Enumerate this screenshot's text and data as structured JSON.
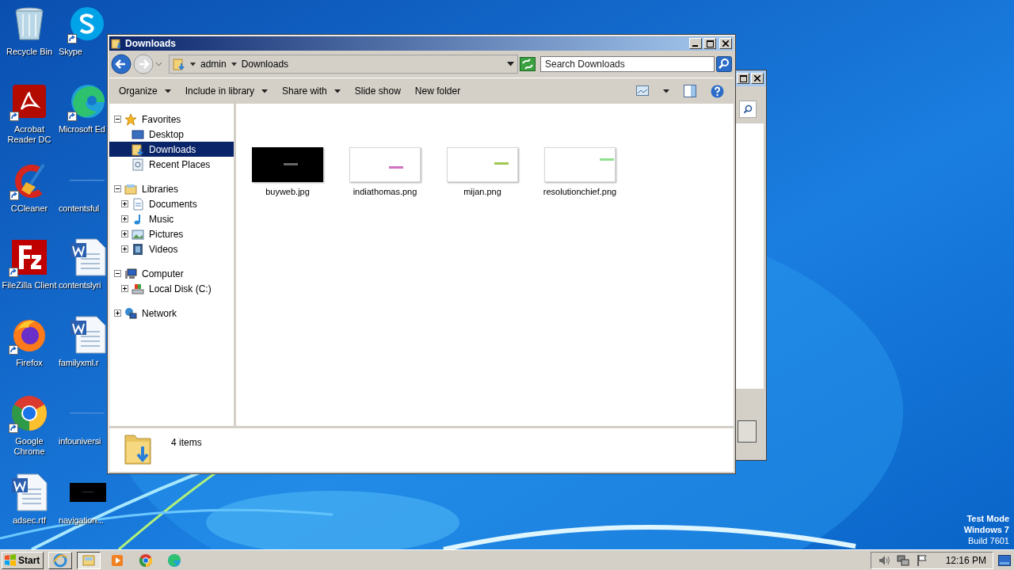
{
  "desktop_icons": [
    {
      "label": "Recycle Bin",
      "kind": "recycle",
      "shortcut": false
    },
    {
      "label": "Acrobat Reader DC",
      "kind": "acrobat",
      "shortcut": true
    },
    {
      "label": "CCleaner",
      "kind": "ccleaner",
      "shortcut": true
    },
    {
      "label": "FileZilla Client",
      "kind": "filezilla",
      "shortcut": true
    },
    {
      "label": "Firefox",
      "kind": "firefox",
      "shortcut": true
    },
    {
      "label": "Google Chrome",
      "kind": "chrome",
      "shortcut": true
    },
    {
      "label": "adsec.rtf",
      "kind": "word",
      "shortcut": false
    },
    {
      "label": "Skype",
      "kind": "skype",
      "shortcut": true
    },
    {
      "label": "Microsoft Ed",
      "kind": "edge",
      "shortcut": true
    },
    {
      "label": "contentsful",
      "kind": "blank",
      "shortcut": false
    },
    {
      "label": "contentslyri",
      "kind": "word",
      "shortcut": false
    },
    {
      "label": "familyxml.r",
      "kind": "word",
      "shortcut": false
    },
    {
      "label": "infouniversi",
      "kind": "blank",
      "shortcut": false
    },
    {
      "label": "navigation...",
      "kind": "dark",
      "shortcut": false
    }
  ],
  "explorer": {
    "title": "Downloads",
    "breadcrumb": [
      "admin",
      "Downloads"
    ],
    "search": {
      "placeholder": "Search Downloads"
    },
    "toolbar": [
      {
        "label": "Organize",
        "has_menu": true
      },
      {
        "label": "Include in library",
        "has_menu": true
      },
      {
        "label": "Share with",
        "has_menu": true
      },
      {
        "label": "Slide show",
        "has_menu": false
      },
      {
        "label": "New folder",
        "has_menu": false
      }
    ],
    "nav_tree": [
      {
        "label": "Favorites",
        "kind": "star",
        "expanded": true,
        "selected": false,
        "children": [
          {
            "label": "Desktop",
            "kind": "desktop",
            "selected": false
          },
          {
            "label": "Downloads",
            "kind": "downloads",
            "selected": true
          },
          {
            "label": "Recent Places",
            "kind": "recent",
            "selected": false
          }
        ]
      },
      {
        "label": "Libraries",
        "kind": "libraries",
        "expanded": true,
        "selected": false,
        "children": [
          {
            "label": "Documents",
            "kind": "documents",
            "expanded": false,
            "selected": false
          },
          {
            "label": "Music",
            "kind": "music",
            "expanded": false,
            "selected": false
          },
          {
            "label": "Pictures",
            "kind": "pictures",
            "expanded": false,
            "selected": false
          },
          {
            "label": "Videos",
            "kind": "videos",
            "expanded": false,
            "selected": false
          }
        ]
      },
      {
        "label": "Computer",
        "kind": "computer",
        "expanded": true,
        "selected": false,
        "children": [
          {
            "label": "Local Disk (C:)",
            "kind": "disk",
            "expanded": false,
            "selected": false
          }
        ]
      },
      {
        "label": "Network",
        "kind": "network",
        "expanded": false,
        "selected": false
      }
    ],
    "files": [
      {
        "name": "buyweb.jpg",
        "kind": "dark",
        "color": "#666666"
      },
      {
        "name": "indiathomas.png",
        "kind": "light",
        "color": "#d070c0"
      },
      {
        "name": "mijan.png",
        "kind": "light",
        "color": "#a0c850"
      },
      {
        "name": "resolutionchief.png",
        "kind": "light",
        "color": "#90e090"
      }
    ],
    "status": "4 items"
  },
  "taskbar": {
    "start_label": "Start",
    "items": [
      {
        "kind": "ie",
        "active": false
      },
      {
        "kind": "explorer",
        "active": true
      },
      {
        "kind": "media",
        "active": false
      },
      {
        "kind": "chrome",
        "active": false
      },
      {
        "kind": "edge",
        "active": false
      }
    ],
    "clock": "12:16 PM"
  },
  "system_notice": [
    "Test Mode",
    "Windows 7",
    "Build 7601"
  ]
}
